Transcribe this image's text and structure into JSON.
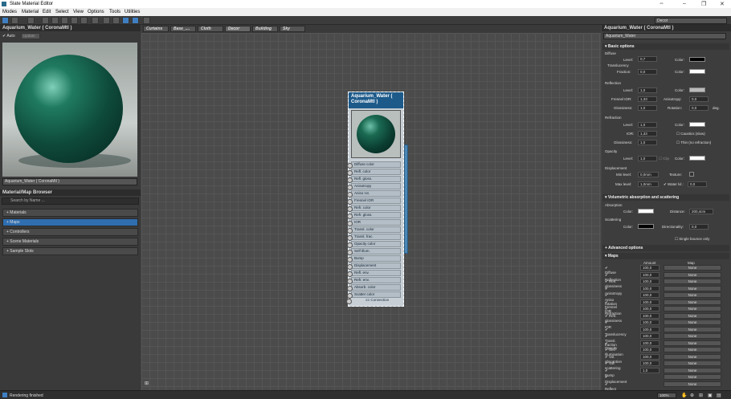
{
  "window": {
    "title": "Slate Material Editor"
  },
  "menu": [
    "Modes",
    "Material",
    "Edit",
    "Select",
    "View",
    "Options",
    "Tools",
    "Utilities"
  ],
  "view_select": "Decor",
  "left": {
    "preview_title": "Aquarium_Water  ( CoronaMtl )",
    "auto_label": "Auto",
    "update_label": "Update",
    "material_name": "Aquarium_Water  ( CoronaMtl )",
    "browser_title": "Material/Map Browser",
    "search_placeholder": "Search by Name ...",
    "groups": [
      "+ Materials",
      "+ Maps",
      "+ Controllers",
      "+ Scene Materials",
      "+ Sample Slots"
    ]
  },
  "tabs": [
    "Curtains",
    "Base_....",
    "Cloth",
    "Decor",
    "Building",
    "Sky"
  ],
  "node": {
    "title": "Aquarium_Water ( CoronaMtl )",
    "slots": [
      "Diffuse color",
      "Refl. color",
      "Refl. gloss.",
      "Anisotropy",
      "Aniso rot.",
      "Fresnel IOR",
      "Refr. color",
      "Refr. gloss.",
      "IOR",
      "Transl. color",
      "Transl. frac.",
      "Opacity color",
      "Self Illum.",
      "Bump",
      "Displacement",
      "Refl. env.",
      "Refr. env.",
      "Absorb. color",
      "Scatter color"
    ],
    "more": "≡≡ Connection"
  },
  "right": {
    "header": "Aquarium_Water ( CoronaMtl )",
    "name": "Aquarium_Water",
    "basic": "Basic options",
    "diffuse": "Diffuse",
    "level": "Level:",
    "diffuse_level": "0,7",
    "color": "Color:",
    "translucency": "Translucency",
    "fraction": "Fraction:",
    "fraction_val": "0,0",
    "reflection": "Reflection",
    "refl_level": "1,0",
    "fresnel": "Fresnel IOR:",
    "fresnel_val": "1,33",
    "anisotropy": "Anisotropy:",
    "aniso_val": "0,0",
    "glossiness": "Glossiness:",
    "refl_gloss": "1,0",
    "rotation": "Rotation:",
    "rot_val": "0,0",
    "deg": "deg.",
    "refraction": "Refraction",
    "refr_level": "1,0",
    "ior": "IOR:",
    "ior_val": "1,33",
    "caustics": "Caustics (slow)",
    "refr_gloss": "1,0",
    "thin": "Thin (no refraction)",
    "opacity": "Opacity",
    "op_level": "1,0",
    "clip": "Clip",
    "displacement": "Displacement",
    "min_level": "Min level:",
    "min_val": "0,0mm",
    "texture": "Texture:",
    "max_level": "Max level:",
    "max_val": "1,0mm",
    "water": "Water lvl.:",
    "water_val": "0,0",
    "vol": "Volumetric absorption and scattering",
    "absorption": "Absorption",
    "distance": "Distance:",
    "dist_val": "200,4cm",
    "scattering": "Scattering",
    "directionality": "Directionality:",
    "dir_val": "0,0",
    "single": "Single bounce only",
    "advanced": "Advanced options",
    "maps": "Maps",
    "amount": "Amount",
    "map": "Map",
    "map_rows": [
      {
        "n": "Diffuse",
        "a": "100,0"
      },
      {
        "n": "Reflection",
        "a": "100,0"
      },
      {
        "n": "Refl. glossiness",
        "a": "100,0"
      },
      {
        "n": "Anisotropy",
        "a": "100,0"
      },
      {
        "n": "Aniso rotation",
        "a": "100,0"
      },
      {
        "n": "Fresnel IOR",
        "a": "100,0"
      },
      {
        "n": "Refraction",
        "a": "100,0"
      },
      {
        "n": "Refr. glossiness",
        "a": "100,0"
      },
      {
        "n": "IOR",
        "a": "100,0"
      },
      {
        "n": "Translucency",
        "a": "100,0"
      },
      {
        "n": "Transl. fraction",
        "a": "100,0"
      },
      {
        "n": "Opacity",
        "a": "100,0"
      },
      {
        "n": "Self Illumination",
        "a": "100,0"
      },
      {
        "n": "Vol. absorption",
        "a": "100,0"
      },
      {
        "n": "Vol. scattering",
        "a": "100,0"
      },
      {
        "n": "Bump",
        "a": "1,0"
      },
      {
        "n": "Displacement",
        "a": ""
      },
      {
        "n": "Reflect BG override",
        "a": ""
      }
    ],
    "none": "None"
  },
  "status": {
    "text": "Rendering finished",
    "zoom": "100%"
  }
}
